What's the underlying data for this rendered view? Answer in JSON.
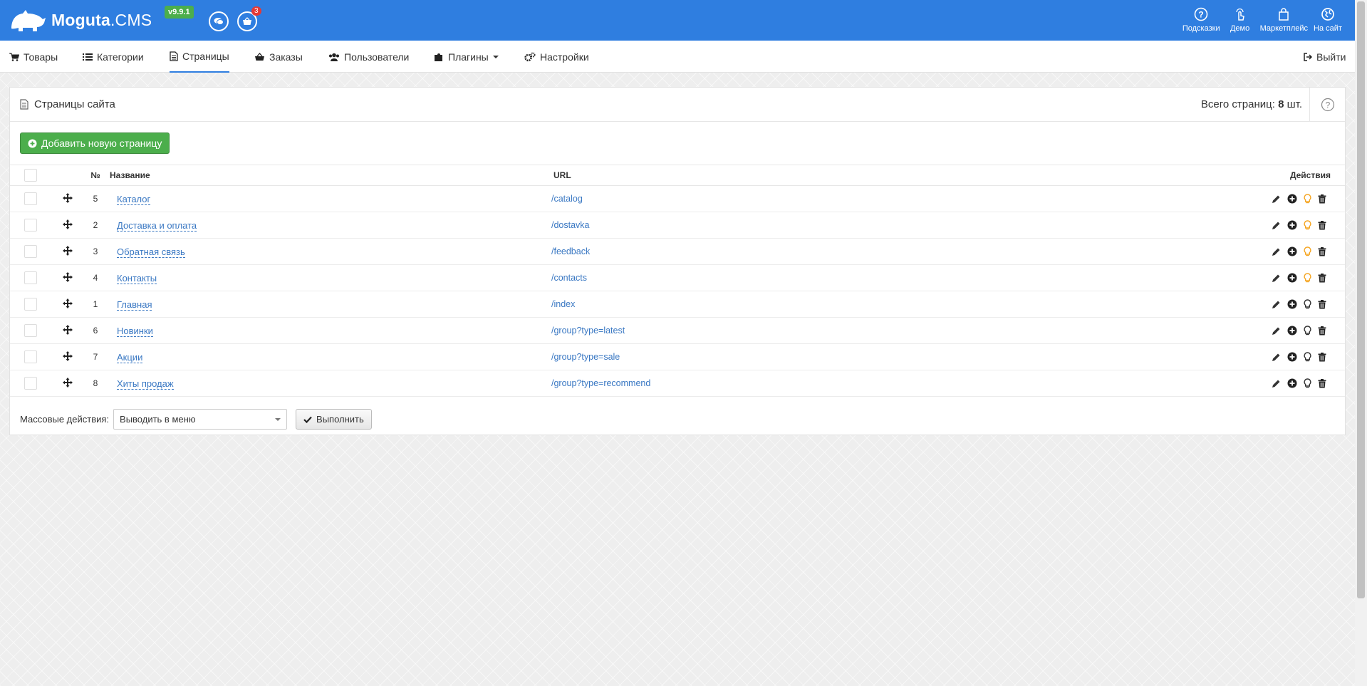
{
  "header": {
    "logo_main": "Moguta",
    "logo_suffix": ".CMS",
    "version": "v9.9.1",
    "cart_badge": "3",
    "links": [
      {
        "label": "Подсказки",
        "icon": "question-icon"
      },
      {
        "label": "Демо",
        "icon": "touch-icon"
      },
      {
        "label": "Маркетплейс",
        "icon": "shopping-bag-icon"
      },
      {
        "label": "На сайт",
        "icon": "globe-icon"
      }
    ]
  },
  "nav": {
    "items": [
      {
        "label": "Товары",
        "icon": "cart-icon"
      },
      {
        "label": "Категории",
        "icon": "list-icon"
      },
      {
        "label": "Страницы",
        "icon": "page-icon"
      },
      {
        "label": "Заказы",
        "icon": "basket-icon"
      },
      {
        "label": "Пользователи",
        "icon": "users-icon"
      },
      {
        "label": "Плагины",
        "icon": "puzzle-icon"
      },
      {
        "label": "Настройки",
        "icon": "gears-icon"
      }
    ],
    "logout": "Выйти"
  },
  "panel": {
    "title": "Страницы сайта",
    "total_label": "Всего страниц:",
    "total_count": "8",
    "total_unit": "шт.",
    "add_button": "Добавить новую страницу"
  },
  "table": {
    "headers": {
      "num": "№",
      "name": "Название",
      "url": "URL",
      "actions": "Действия"
    },
    "rows": [
      {
        "num": "5",
        "name": "Каталог",
        "url": "/catalog",
        "visible": true
      },
      {
        "num": "2",
        "name": "Доставка и оплата",
        "url": "/dostavka",
        "visible": true
      },
      {
        "num": "3",
        "name": "Обратная связь",
        "url": "/feedback",
        "visible": true
      },
      {
        "num": "4",
        "name": "Контакты",
        "url": "/contacts",
        "visible": true
      },
      {
        "num": "1",
        "name": "Главная",
        "url": "/index",
        "visible": false
      },
      {
        "num": "6",
        "name": "Новинки",
        "url": "/group?type=latest",
        "visible": false
      },
      {
        "num": "7",
        "name": "Акции",
        "url": "/group?type=sale",
        "visible": false
      },
      {
        "num": "8",
        "name": "Хиты продаж",
        "url": "/group?type=recommend",
        "visible": false
      }
    ]
  },
  "mass": {
    "label": "Массовые действия:",
    "selected": "Выводить в меню",
    "execute": "Выполнить"
  },
  "colors": {
    "primary": "#2f7ee0",
    "success": "#4cae4c",
    "link": "#3a78c3",
    "bulb_on": "#f5a623"
  }
}
